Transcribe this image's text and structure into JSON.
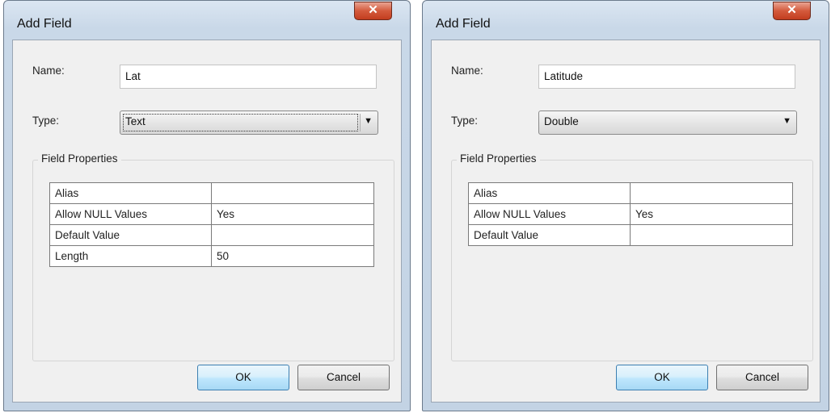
{
  "dialogs": [
    {
      "title": "Add Field",
      "close_glyph": "✕",
      "name_label": "Name:",
      "name_value": "Lat",
      "type_label": "Type:",
      "type_value": "Text",
      "dropdown_arrow": "▼",
      "field_properties_title": "Field Properties",
      "properties": [
        {
          "key": "Alias",
          "value": ""
        },
        {
          "key": "Allow NULL Values",
          "value": "Yes"
        },
        {
          "key": "Default Value",
          "value": ""
        },
        {
          "key": "Length",
          "value": "50"
        }
      ],
      "ok_label": "OK",
      "cancel_label": "Cancel"
    },
    {
      "title": "Add Field",
      "close_glyph": "✕",
      "name_label": "Name:",
      "name_value": "Latitude",
      "type_label": "Type:",
      "type_value": "Double",
      "dropdown_arrow": "▼",
      "field_properties_title": "Field Properties",
      "properties": [
        {
          "key": "Alias",
          "value": ""
        },
        {
          "key": "Allow NULL Values",
          "value": "Yes"
        },
        {
          "key": "Default Value",
          "value": ""
        }
      ],
      "ok_label": "OK",
      "cancel_label": "Cancel"
    }
  ],
  "colors": {
    "title_bar": "#c9d8e8",
    "close_button": "#c94a2d",
    "ok_button_border": "#3c7fb1",
    "dialog_face": "#f0f0f0"
  }
}
